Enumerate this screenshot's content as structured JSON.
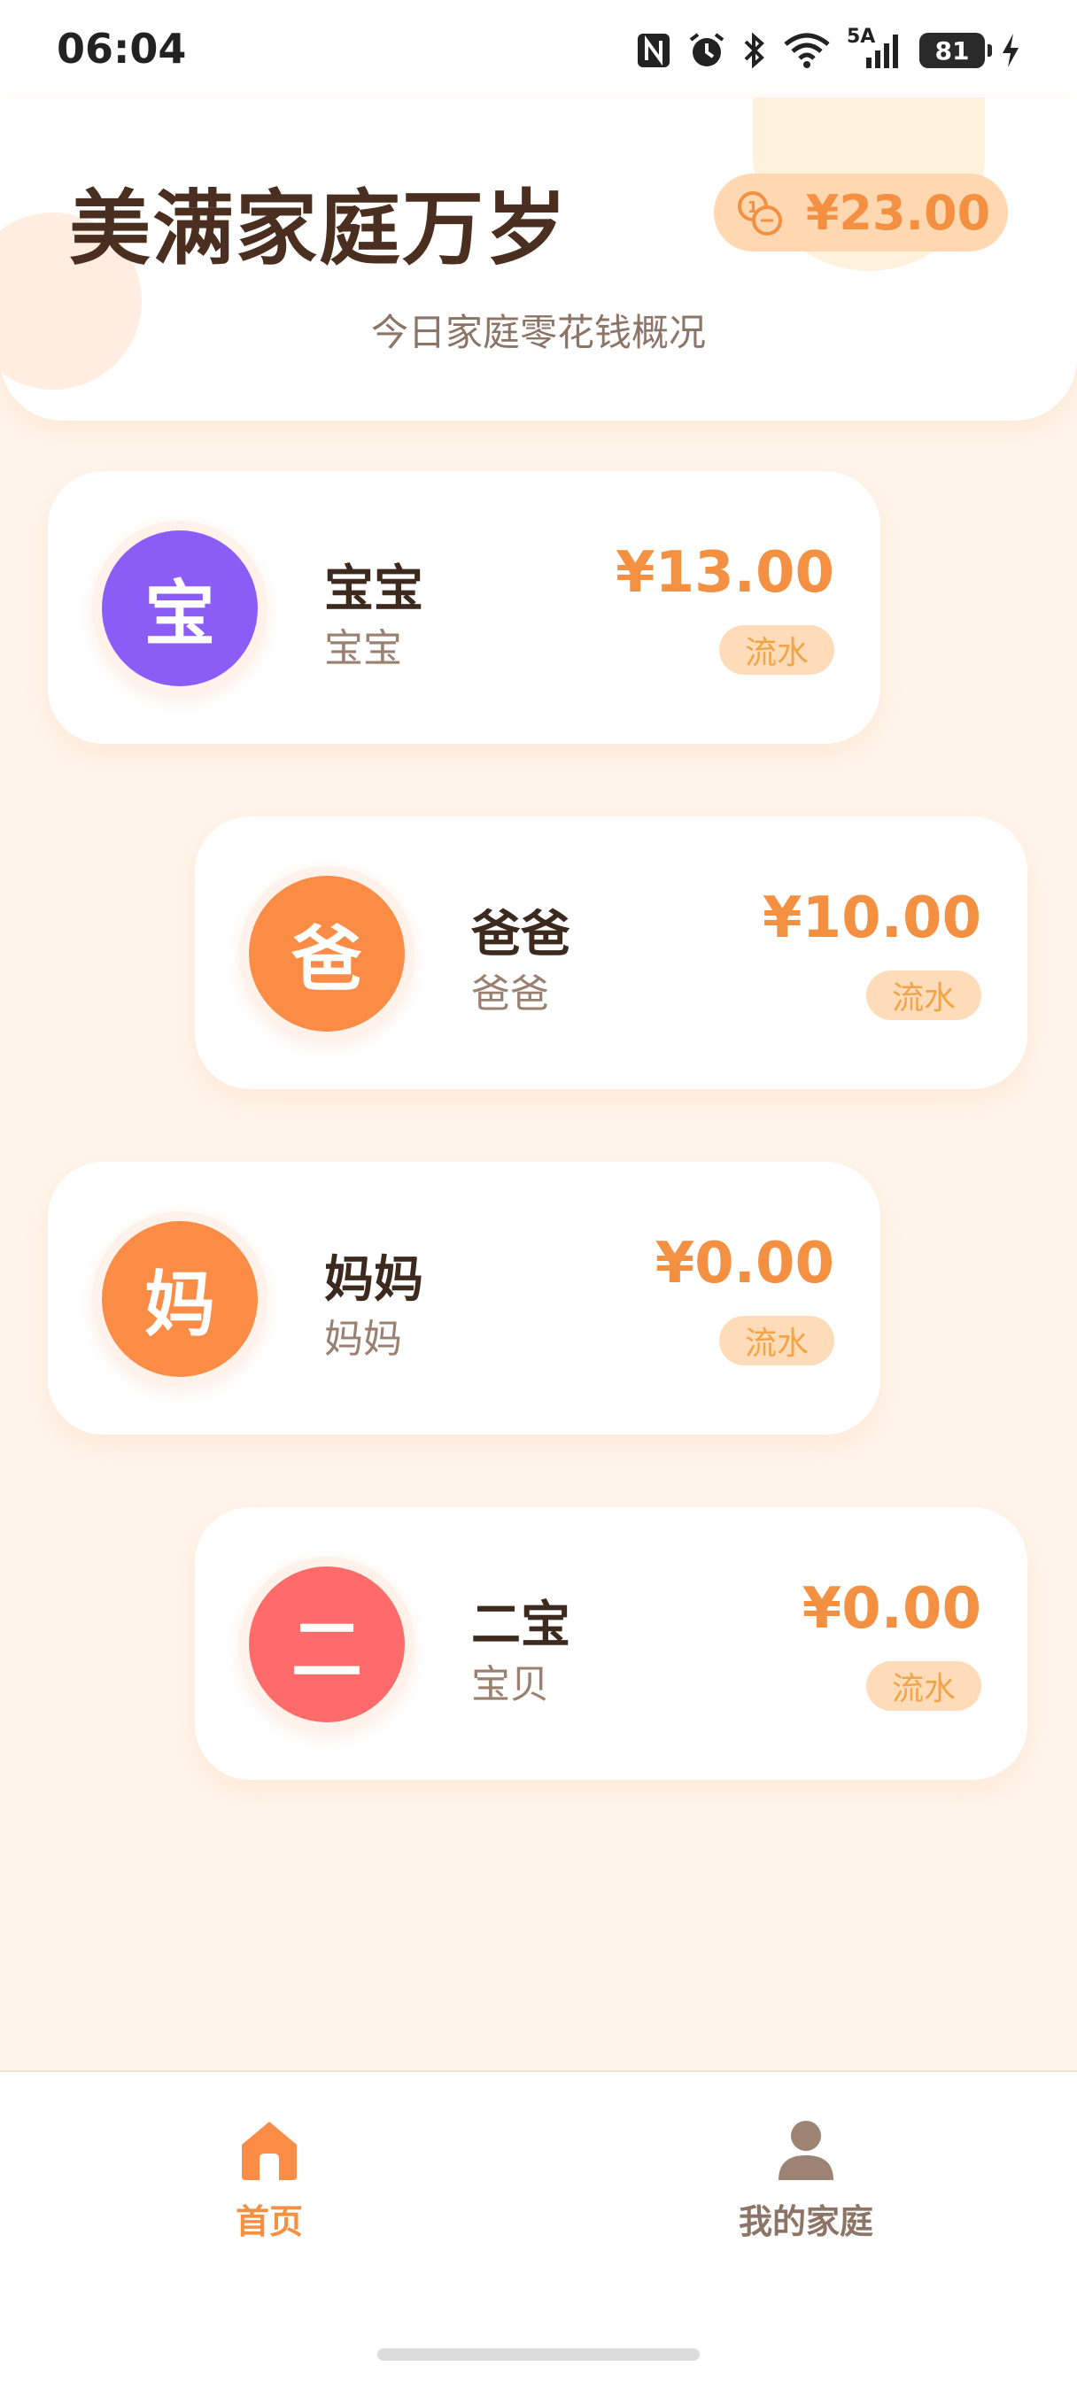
{
  "status_bar": {
    "time": "06:04",
    "network": "5A",
    "battery": "81",
    "icons": [
      "nfc-icon",
      "alarm-icon",
      "bluetooth-icon",
      "wifi-icon",
      "signal-icon",
      "battery-icon",
      "charging-icon"
    ]
  },
  "header": {
    "title": "美满家庭万岁",
    "total_amount": "¥23.00",
    "total_icon": "coins-icon",
    "subtitle": "今日家庭零花钱概况"
  },
  "members": [
    {
      "avatar_char": "宝",
      "name": "宝宝",
      "role": "宝宝",
      "amount": "¥13.00",
      "flow_label": "流水",
      "color": "#8b5cf6"
    },
    {
      "avatar_char": "爸",
      "name": "爸爸",
      "role": "爸爸",
      "amount": "¥10.00",
      "flow_label": "流水",
      "color": "#fb8c46"
    },
    {
      "avatar_char": "妈",
      "name": "妈妈",
      "role": "妈妈",
      "amount": "¥0.00",
      "flow_label": "流水",
      "color": "#fb8c46"
    },
    {
      "avatar_char": "二",
      "name": "二宝",
      "role": "宝贝",
      "amount": "¥0.00",
      "flow_label": "流水",
      "color": "#ff6b6b"
    }
  ],
  "nav": {
    "home_label": "首页",
    "family_label": "我的家庭",
    "active": "home"
  },
  "colors": {
    "accent": "#f39042",
    "background": "#fff5eb",
    "badge": "#ffdcb9"
  }
}
